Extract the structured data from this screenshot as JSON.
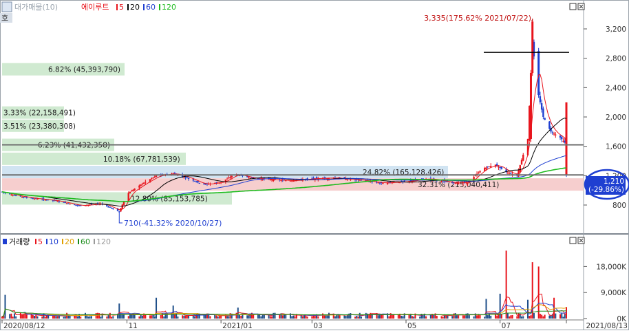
{
  "price_panel": {
    "legend": [
      {
        "label": "대가매물(10)",
        "color": "#9aa4ae"
      },
      {
        "label": "에이루트",
        "color": "#e8141c"
      },
      {
        "label": "5",
        "color": "#e8141c"
      },
      {
        "label": "20",
        "color": "#000000"
      },
      {
        "label": "60",
        "color": "#1f3fd1"
      },
      {
        "label": "120",
        "color": "#1dbb1d"
      }
    ],
    "collapse_label": "호",
    "high_annotation": "3,335(175.62% 2021/07/22)",
    "low_annotation": "710(-41.32% 2020/10/27)",
    "current_price": "1,210",
    "current_change": "(-29.86%)"
  },
  "volume_panel": {
    "legend": [
      {
        "label": "거래량",
        "color": "#000000"
      },
      {
        "label": "5",
        "color": "#e8141c"
      },
      {
        "label": "10",
        "color": "#1f3fd1"
      },
      {
        "label": "20",
        "color": "#e0a000"
      },
      {
        "label": "60",
        "color": "#1a8c1a"
      },
      {
        "label": "120",
        "color": "#9a9a9a"
      }
    ]
  },
  "window_buttons": {
    "restore": "□",
    "close": "×"
  },
  "chart_data": [
    {
      "type": "line",
      "title": "",
      "xlabel": "",
      "ylabel": "",
      "ylim": [
        500,
        3500
      ],
      "yticks": [
        800,
        1200,
        1600,
        2000,
        2400,
        2800,
        3200
      ],
      "ytick_labels": [
        "800",
        "1,200",
        "1,600",
        "2,000",
        "2,400",
        "2,800",
        "3,200"
      ],
      "x_start": "2020/08/12",
      "x_end": "2021/08/13",
      "x_tick_labels": [
        "2020/08/12",
        "11",
        "2021/01",
        "03",
        "05",
        "07",
        "2021/08/13"
      ],
      "x_tick_dates": [
        "2020-08-12",
        "2020-11-01",
        "2021-01-01",
        "2021-03-01",
        "2021-05-01",
        "2021-07-01",
        "2021-08-13"
      ],
      "price_close": [
        {
          "date": "2020-08-12",
          "close": 980
        },
        {
          "date": "2020-08-20",
          "close": 930
        },
        {
          "date": "2020-09-01",
          "close": 890
        },
        {
          "date": "2020-09-15",
          "close": 860
        },
        {
          "date": "2020-10-01",
          "close": 790
        },
        {
          "date": "2020-10-15",
          "close": 820
        },
        {
          "date": "2020-10-27",
          "close": 710
        },
        {
          "date": "2020-11-01",
          "close": 950
        },
        {
          "date": "2020-11-10",
          "close": 1080
        },
        {
          "date": "2020-11-20",
          "close": 1200
        },
        {
          "date": "2020-12-01",
          "close": 1230
        },
        {
          "date": "2020-12-10",
          "close": 1170
        },
        {
          "date": "2020-12-20",
          "close": 1080
        },
        {
          "date": "2021-01-01",
          "close": 1110
        },
        {
          "date": "2021-01-10",
          "close": 1220
        },
        {
          "date": "2021-01-20",
          "close": 1170
        },
        {
          "date": "2021-02-01",
          "close": 1150
        },
        {
          "date": "2021-02-15",
          "close": 1130
        },
        {
          "date": "2021-03-01",
          "close": 1160
        },
        {
          "date": "2021-03-15",
          "close": 1170
        },
        {
          "date": "2021-04-01",
          "close": 1140
        },
        {
          "date": "2021-04-15",
          "close": 1100
        },
        {
          "date": "2021-05-01",
          "close": 1120
        },
        {
          "date": "2021-05-15",
          "close": 1160
        },
        {
          "date": "2021-06-01",
          "close": 1100
        },
        {
          "date": "2021-06-10",
          "close": 1110
        },
        {
          "date": "2021-06-20",
          "close": 1300
        },
        {
          "date": "2021-06-28",
          "close": 1350
        },
        {
          "date": "2021-07-05",
          "close": 1250
        },
        {
          "date": "2021-07-12",
          "close": 1200
        },
        {
          "date": "2021-07-19",
          "close": 1700
        },
        {
          "date": "2021-07-21",
          "close": 2600
        },
        {
          "date": "2021-07-22",
          "close": 3000
        },
        {
          "date": "2021-07-26",
          "close": 2300
        },
        {
          "date": "2021-07-29",
          "close": 2000
        },
        {
          "date": "2021-08-03",
          "close": 1800
        },
        {
          "date": "2021-08-09",
          "close": 1720
        },
        {
          "date": "2021-08-12",
          "close": 1650
        },
        {
          "date": "2021-08-13",
          "close": 1210
        }
      ],
      "volume_profile": [
        {
          "label": "6.82% (45,393,790)",
          "price": 2650
        },
        {
          "label": "3.33% (22,158,491)",
          "price": 2060
        },
        {
          "label": "3.51% (23,380,308)",
          "price": 1880
        },
        {
          "label": "6.23% (41,432,358)",
          "price": 1620
        },
        {
          "label": "10.18% (67,781,539)",
          "price": 1430
        },
        {
          "label": "24.82% (165,128,426)",
          "price": 1250
        },
        {
          "label": "32.31% (215,040,411)",
          "price": 1080
        },
        {
          "label": "12.80% (85,153,785)",
          "price": 890
        }
      ],
      "horizontal_lines": [
        2880,
        1620,
        1210
      ]
    },
    {
      "type": "bar",
      "title": "",
      "xlabel": "",
      "ylabel": "",
      "ylim": [
        0,
        25000
      ],
      "yticks": [
        0,
        9000,
        18000
      ],
      "ytick_labels": [
        "0K",
        "9,000K",
        "18,000K"
      ],
      "volume_k": [
        {
          "date": "2020-08-14",
          "volume": 8200
        },
        {
          "date": "2020-08-20",
          "volume": 1800
        },
        {
          "date": "2020-09-01",
          "volume": 1200
        },
        {
          "date": "2020-09-20",
          "volume": 900
        },
        {
          "date": "2020-10-27",
          "volume": 5200
        },
        {
          "date": "2020-11-05",
          "volume": 1500
        },
        {
          "date": "2020-11-20",
          "volume": 7200
        },
        {
          "date": "2020-12-01",
          "volume": 4500
        },
        {
          "date": "2021-01-12",
          "volume": 3800
        },
        {
          "date": "2021-02-15",
          "volume": 1800
        },
        {
          "date": "2021-03-20",
          "volume": 2500
        },
        {
          "date": "2021-04-10",
          "volume": 1400
        },
        {
          "date": "2021-05-20",
          "volume": 1800
        },
        {
          "date": "2021-06-22",
          "volume": 6800
        },
        {
          "date": "2021-07-01",
          "volume": 8600
        },
        {
          "date": "2021-07-05",
          "volume": 23500
        },
        {
          "date": "2021-07-19",
          "volume": 6500
        },
        {
          "date": "2021-07-22",
          "volume": 19500
        },
        {
          "date": "2021-07-26",
          "volume": 18000
        },
        {
          "date": "2021-08-05",
          "volume": 7200
        },
        {
          "date": "2021-08-13",
          "volume": 4000
        }
      ]
    }
  ]
}
